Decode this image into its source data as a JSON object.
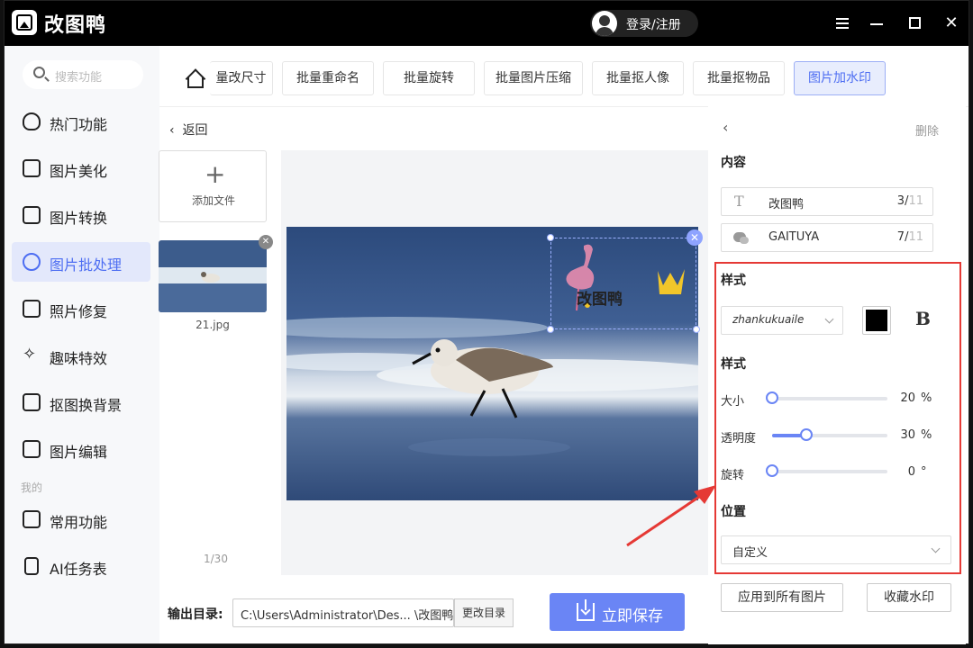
{
  "app": {
    "title": "改图鸭",
    "login_label": "登录/注册"
  },
  "sidebar": {
    "search_placeholder": "搜索功能",
    "items": [
      {
        "label": "热门功能",
        "icon": "fire-icon"
      },
      {
        "label": "图片美化",
        "icon": "image-beautify-icon"
      },
      {
        "label": "图片转换",
        "icon": "convert-icon"
      },
      {
        "label": "图片批处理",
        "icon": "batch-icon",
        "active": true
      },
      {
        "label": "照片修复",
        "icon": "photo-repair-icon"
      },
      {
        "label": "趣味特效",
        "icon": "magic-icon"
      },
      {
        "label": "抠图换背景",
        "icon": "cutout-icon"
      },
      {
        "label": "图片编辑",
        "icon": "image-edit-icon"
      }
    ],
    "section_mine": "我的",
    "mine_items": [
      {
        "label": "常用功能",
        "icon": "grid-icon"
      },
      {
        "label": "AI任务表",
        "icon": "document-icon"
      }
    ]
  },
  "toolbar": {
    "tabs": [
      "量改尺寸",
      "批量重命名",
      "批量旋转",
      "批量图片压缩",
      "批量抠人像",
      "批量抠物品",
      "图片加水印"
    ],
    "active_tab": "图片加水印"
  },
  "main": {
    "back_label": "返回",
    "add_file_label": "添加文件",
    "file_name": "21.jpg",
    "pager": "1/30",
    "watermark_text": "改图鸭",
    "output_label": "输出目录:",
    "output_path": "C:\\Users\\Administrator\\Des... \\改图鸭",
    "change_dir_label": "更改目录",
    "save_label": "立即保存"
  },
  "panel": {
    "delete_label": "删除",
    "content_heading": "内容",
    "content_rows": [
      {
        "icon": "text-icon",
        "text": "改图鸭",
        "count": "3/",
        "max": "11"
      },
      {
        "icon": "wechat-icon",
        "text": "GAITUYA",
        "count": "7/",
        "max": "11"
      }
    ],
    "style_heading": "样式",
    "font_value": "zhankukuaile",
    "color": "#000000",
    "bold_label": "B",
    "style_heading_2": "样式",
    "sliders": [
      {
        "label": "大小",
        "value": "20",
        "unit": "%",
        "fraction": 0.0
      },
      {
        "label": "透明度",
        "value": "30",
        "unit": "%",
        "fraction": 0.3
      },
      {
        "label": "旋转",
        "value": "0",
        "unit": "°",
        "fraction": 0.0
      }
    ],
    "position_heading": "位置",
    "position_value": "自定义",
    "apply_all_label": "应用到所有图片",
    "favorite_label": "收藏水印"
  },
  "colors": {
    "accent": "#6a85f5",
    "highlight": "#e53935",
    "titlebar": "#000000"
  }
}
